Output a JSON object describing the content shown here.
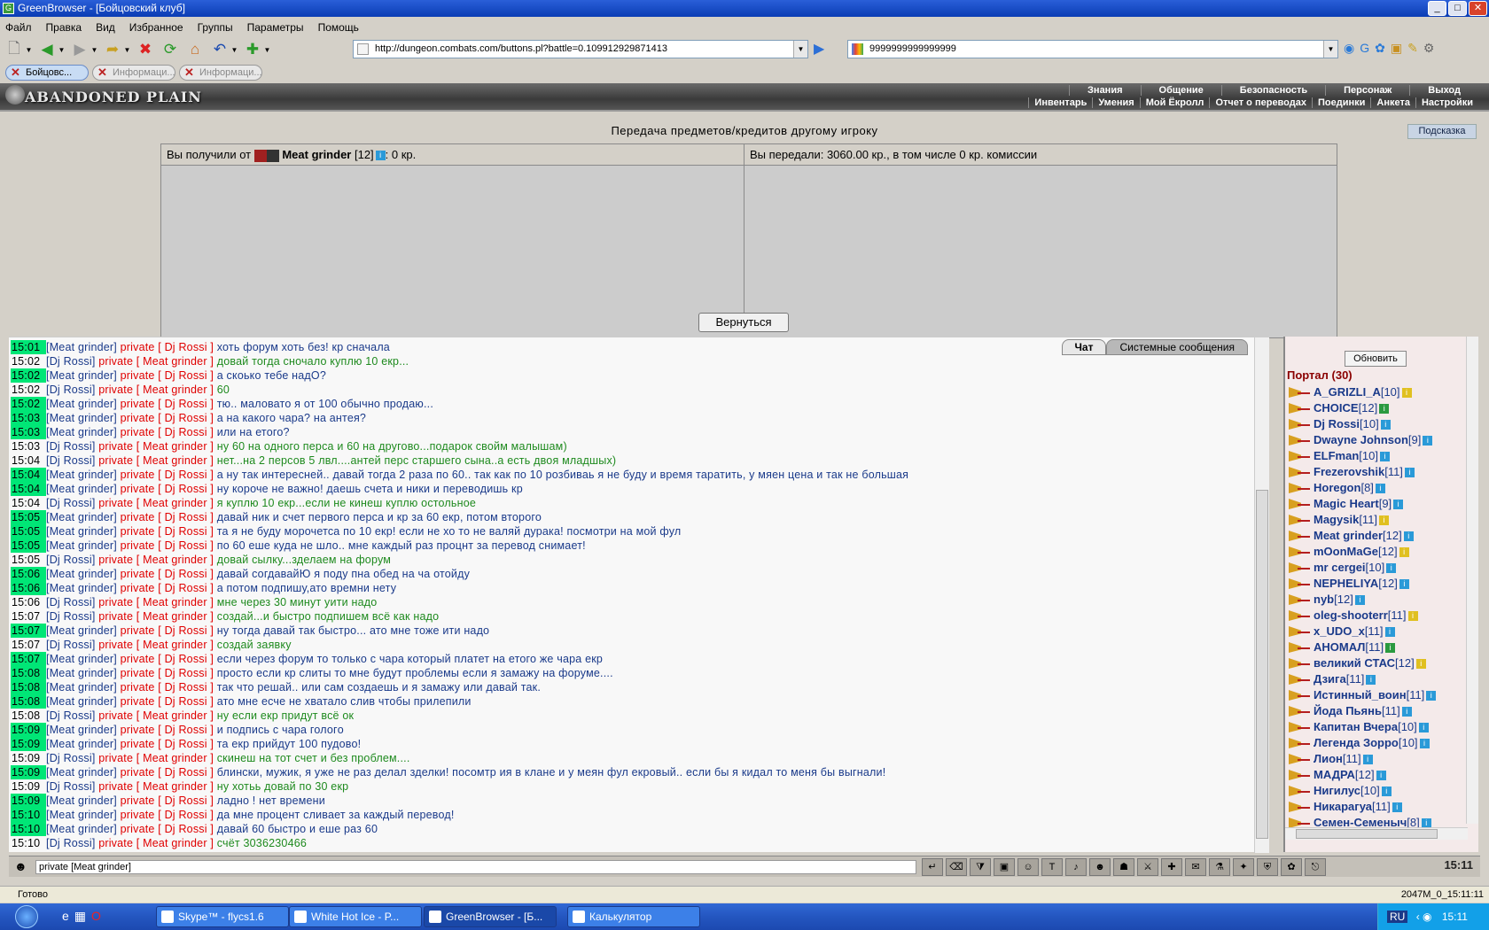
{
  "window": {
    "title": "GreenBrowser - [Бойцовский клуб]",
    "app_icon": "G"
  },
  "menu": [
    "Файл",
    "Правка",
    "Вид",
    "Избранное",
    "Группы",
    "Параметры",
    "Помощь"
  ],
  "address": {
    "url": "http://dungeon.combats.com/buttons.pl?battle=0.109912929871413"
  },
  "search": {
    "value": "9999999999999999"
  },
  "tabs": [
    {
      "label": "Бойцовс...",
      "active": true
    },
    {
      "label": "Информаци...",
      "active": false
    },
    {
      "label": "Информаци...",
      "active": false
    }
  ],
  "game": {
    "logo": "ABANDONED PLAIN",
    "nav_top": [
      "Знания",
      "Общение",
      "Безопасность",
      "Персонаж",
      "Выход"
    ],
    "nav_bottom": [
      "Инвентарь",
      "Умения",
      "Мой Ёкролл",
      "Отчет о переводах",
      "Поединки",
      "Анкета",
      "Настройки"
    ]
  },
  "transfer": {
    "title": "Передача предметов/кредитов другому игроку",
    "hint_label": "Подсказка",
    "received_prefix": "Вы получили от",
    "received_nick": "Meat grinder",
    "received_level": "[12]",
    "received_amount": ": 0 кр.",
    "sent_text": "Вы передали: 3060.00 кр., в том числе 0 кр. комиссии",
    "back_label": "Вернуться"
  },
  "chat": {
    "tabs": [
      "Чат",
      "Системные сообщения"
    ],
    "lines": [
      {
        "t": "15:01",
        "hl": true,
        "from": "Meat grinder",
        "to": "Dj Rossi",
        "text": "хоть форум хоть без! кр сначала",
        "c": "blue"
      },
      {
        "t": "15:02",
        "hl": false,
        "from": "Dj Rossi",
        "to": "Meat grinder",
        "text": "довай тогда сночало куплю 10 екр...",
        "c": "green"
      },
      {
        "t": "15:02",
        "hl": true,
        "from": "Meat grinder",
        "to": "Dj Rossi",
        "text": "а скоько тебе надО?",
        "c": "blue"
      },
      {
        "t": "15:02",
        "hl": false,
        "from": "Dj Rossi",
        "to": "Meat grinder",
        "text": "60",
        "c": "green"
      },
      {
        "t": "15:02",
        "hl": true,
        "from": "Meat grinder",
        "to": "Dj Rossi",
        "text": "тю.. маловато я от 100 обычно продаю...",
        "c": "blue"
      },
      {
        "t": "15:03",
        "hl": true,
        "from": "Meat grinder",
        "to": "Dj Rossi",
        "text": "а на какого чара? на антея?",
        "c": "blue"
      },
      {
        "t": "15:03",
        "hl": true,
        "from": "Meat grinder",
        "to": "Dj Rossi",
        "text": "или на етого?",
        "c": "blue"
      },
      {
        "t": "15:03",
        "hl": false,
        "from": "Dj Rossi",
        "to": "Meat grinder",
        "text": "ну 60 на одного перса и 60 на другово...подарок свойм малышам)",
        "c": "green"
      },
      {
        "t": "15:04",
        "hl": false,
        "from": "Dj Rossi",
        "to": "Meat grinder",
        "text": "нет...на 2 персов 5 лвл....антей перс старшего сына..а есть двоя младшых)",
        "c": "green"
      },
      {
        "t": "15:04",
        "hl": true,
        "from": "Meat grinder",
        "to": "Dj Rossi",
        "text": "а ну так интересней.. давай тогда 2 раза по 60.. так как по 10 розбиваь я не буду и время таратить, у мяен цена и так не большая",
        "c": "blue"
      },
      {
        "t": "15:04",
        "hl": true,
        "from": "Meat grinder",
        "to": "Dj Rossi",
        "text": "ну короче не важно! даешь счета и ники и переводишь кр",
        "c": "blue"
      },
      {
        "t": "15:04",
        "hl": false,
        "from": "Dj Rossi",
        "to": "Meat grinder",
        "text": "я куплю 10 екр...если не кинеш куплю остольное",
        "c": "green"
      },
      {
        "t": "15:05",
        "hl": true,
        "from": "Meat grinder",
        "to": "Dj Rossi",
        "text": "давай ник и счет первого перса и кр за 60 екр, потом второго",
        "c": "blue"
      },
      {
        "t": "15:05",
        "hl": true,
        "from": "Meat grinder",
        "to": "Dj Rossi",
        "text": "та я не буду морочетса по 10 екр! если не хо то не валяй дурака! посмотри на мой фул",
        "c": "blue"
      },
      {
        "t": "15:05",
        "hl": true,
        "from": "Meat grinder",
        "to": "Dj Rossi",
        "text": "по 60 еше куда не шло.. мне каждый раз процнт за перевод снимает!",
        "c": "blue"
      },
      {
        "t": "15:05",
        "hl": false,
        "from": "Dj Rossi",
        "to": "Meat grinder",
        "text": "довай сылку...зделаем на форум",
        "c": "green"
      },
      {
        "t": "15:06",
        "hl": true,
        "from": "Meat grinder",
        "to": "Dj Rossi",
        "text": "давай согдавайЮ я поду пна обед на ча отойду",
        "c": "blue"
      },
      {
        "t": "15:06",
        "hl": true,
        "from": "Meat grinder",
        "to": "Dj Rossi",
        "text": "а потом подпишу,ато времни нету",
        "c": "blue"
      },
      {
        "t": "15:06",
        "hl": false,
        "from": "Dj Rossi",
        "to": "Meat grinder",
        "text": "мне через 30 минут уити надо",
        "c": "green"
      },
      {
        "t": "15:07",
        "hl": false,
        "from": "Dj Rossi",
        "to": "Meat grinder",
        "text": "создай...и быстро подпишем всё как надо",
        "c": "green"
      },
      {
        "t": "15:07",
        "hl": true,
        "from": "Meat grinder",
        "to": "Dj Rossi",
        "text": "ну тогда давай так быстро... ато мне тоже ити надо",
        "c": "blue"
      },
      {
        "t": "15:07",
        "hl": false,
        "from": "Dj Rossi",
        "to": "Meat grinder",
        "text": "создай заявку",
        "c": "green"
      },
      {
        "t": "15:07",
        "hl": true,
        "from": "Meat grinder",
        "to": "Dj Rossi",
        "text": "если через форум то только с чара который платет на етого же чара екр",
        "c": "blue"
      },
      {
        "t": "15:08",
        "hl": true,
        "from": "Meat grinder",
        "to": "Dj Rossi",
        "text": "просто если кр слиты то мне будут проблемы если я замажу на форуме....",
        "c": "blue"
      },
      {
        "t": "15:08",
        "hl": true,
        "from": "Meat grinder",
        "to": "Dj Rossi",
        "text": "так что решай.. или сам создаешь и я замажу или давай так.",
        "c": "blue"
      },
      {
        "t": "15:08",
        "hl": true,
        "from": "Meat grinder",
        "to": "Dj Rossi",
        "text": "ато мне есче не хватало слив чтобы прилепили",
        "c": "blue"
      },
      {
        "t": "15:08",
        "hl": false,
        "from": "Dj Rossi",
        "to": "Meat grinder",
        "text": "ну если екр придут всё ок",
        "c": "green"
      },
      {
        "t": "15:09",
        "hl": true,
        "from": "Meat grinder",
        "to": "Dj Rossi",
        "text": "и подпись с чара гологo",
        "c": "blue"
      },
      {
        "t": "15:09",
        "hl": true,
        "from": "Meat grinder",
        "to": "Dj Rossi",
        "text": "та екр прийдут 100 пудово!",
        "c": "blue"
      },
      {
        "t": "15:09",
        "hl": false,
        "from": "Dj Rossi",
        "to": "Meat grinder",
        "text": "скинеш на тот счет и без проблем....",
        "c": "green"
      },
      {
        "t": "15:09",
        "hl": true,
        "from": "Meat grinder",
        "to": "Dj Rossi",
        "text": "блински, мужик, я уже не раз делал зделки! посомтр ия в клане и у меян фул екровый.. если бы я кидал то меня бы выгнали!",
        "c": "blue"
      },
      {
        "t": "15:09",
        "hl": false,
        "from": "Dj Rossi",
        "to": "Meat grinder",
        "text": "ну хотьь довай по 30 екр",
        "c": "green"
      },
      {
        "t": "15:09",
        "hl": true,
        "from": "Meat grinder",
        "to": "Dj Rossi",
        "text": "ладно ! нет времени",
        "c": "blue"
      },
      {
        "t": "15:10",
        "hl": true,
        "from": "Meat grinder",
        "to": "Dj Rossi",
        "text": "да мне процент сливает за каждый перевод!",
        "c": "blue"
      },
      {
        "t": "15:10",
        "hl": true,
        "from": "Meat grinder",
        "to": "Dj Rossi",
        "text": "давай 60 быстро и еше раз 60",
        "c": "blue"
      },
      {
        "t": "15:10",
        "hl": false,
        "from": "Dj Rossi",
        "to": "Meat grinder",
        "text": "счёт 3036230466",
        "c": "green"
      }
    ],
    "input_value": "private [Meat grinder]",
    "clock": "15:11"
  },
  "side": {
    "refresh_label": "Обновить",
    "location": "Портал (30)",
    "users": [
      {
        "name": "A_GRIZLI_A",
        "lvl": "[10]",
        "info": "gold"
      },
      {
        "name": "CHOICE",
        "lvl": "[12]",
        "info": "green"
      },
      {
        "name": "Dj Rossi",
        "lvl": "[10]",
        "info": "blue"
      },
      {
        "name": "Dwayne Johnson",
        "lvl": "[9]",
        "info": "blue"
      },
      {
        "name": "ELFman",
        "lvl": "[10]",
        "info": "blue"
      },
      {
        "name": "Frezerovshik",
        "lvl": "[11]",
        "info": "blue"
      },
      {
        "name": "Horegon",
        "lvl": "[8]",
        "info": "blue"
      },
      {
        "name": "Magic Heart",
        "lvl": "[9]",
        "info": "blue"
      },
      {
        "name": "Magysik",
        "lvl": "[11]",
        "info": "gold"
      },
      {
        "name": "Meat grinder",
        "lvl": "[12]",
        "info": "blue"
      },
      {
        "name": "mOonMaGe",
        "lvl": "[12]",
        "info": "gold"
      },
      {
        "name": "mr cergei",
        "lvl": "[10]",
        "info": "blue"
      },
      {
        "name": "NEPHELIYA",
        "lvl": "[12]",
        "info": "blue"
      },
      {
        "name": "nyb",
        "lvl": "[12]",
        "info": "blue"
      },
      {
        "name": "oleg-shooterr",
        "lvl": "[11]",
        "info": "gold"
      },
      {
        "name": "x_UDO_x",
        "lvl": "[11]",
        "info": "blue"
      },
      {
        "name": "АНОМАЛ",
        "lvl": "[11]",
        "info": "green"
      },
      {
        "name": "великий СТАС",
        "lvl": "[12]",
        "info": "gold"
      },
      {
        "name": "Дзига",
        "lvl": "[11]",
        "info": "blue"
      },
      {
        "name": "Истинный_воин",
        "lvl": "[11]",
        "info": "blue"
      },
      {
        "name": "Йода Пьянь",
        "lvl": "[11]",
        "info": "blue"
      },
      {
        "name": "Капитан Вчера",
        "lvl": "[10]",
        "info": "blue"
      },
      {
        "name": "Легенда Зорро",
        "lvl": "[10]",
        "info": "blue"
      },
      {
        "name": "Лион",
        "lvl": "[11]",
        "info": "blue"
      },
      {
        "name": "МАДРА",
        "lvl": "[12]",
        "info": "blue"
      },
      {
        "name": "Нигилус",
        "lvl": "[10]",
        "info": "blue"
      },
      {
        "name": "Никарагуа",
        "lvl": "[11]",
        "info": "blue"
      },
      {
        "name": "Семен-Семеныч",
        "lvl": "[8]",
        "info": "blue"
      }
    ]
  },
  "status": {
    "text": "Готово",
    "right": "2047M_0_15:11:11"
  },
  "taskbar": {
    "items": [
      {
        "label": "Skype™ - flycs1.6",
        "active": false
      },
      {
        "label": "White Hot Ice - P...",
        "active": false
      },
      {
        "label": "GreenBrowser - [Б...",
        "active": true
      },
      {
        "label": "Калькулятор",
        "active": false
      }
    ],
    "lang": "RU",
    "clock": "15:11"
  }
}
